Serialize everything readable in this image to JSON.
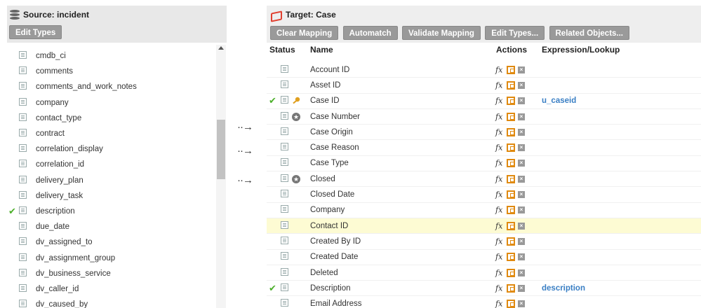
{
  "source": {
    "title": "Source: incident",
    "edit_types_label": "Edit Types",
    "rows": [
      {
        "label": "",
        "checked": false
      },
      {
        "label": "cmdb_ci",
        "checked": false
      },
      {
        "label": "comments",
        "checked": false
      },
      {
        "label": "comments_and_work_notes",
        "checked": false
      },
      {
        "label": "company",
        "checked": false
      },
      {
        "label": "contact_type",
        "checked": false
      },
      {
        "label": "contract",
        "checked": false
      },
      {
        "label": "correlation_display",
        "checked": false
      },
      {
        "label": "correlation_id",
        "checked": false
      },
      {
        "label": "delivery_plan",
        "checked": false
      },
      {
        "label": "delivery_task",
        "checked": false
      },
      {
        "label": "description",
        "checked": true
      },
      {
        "label": "due_date",
        "checked": false
      },
      {
        "label": "dv_assigned_to",
        "checked": false
      },
      {
        "label": "dv_assignment_group",
        "checked": false
      },
      {
        "label": "dv_business_service",
        "checked": false
      },
      {
        "label": "dv_caller_id",
        "checked": false
      },
      {
        "label": "dv_caused_by",
        "checked": false
      }
    ]
  },
  "arrows": [
    "··→",
    "··→",
    "··→"
  ],
  "target": {
    "title": "Target: Case",
    "buttons": {
      "clear_mapping": "Clear Mapping",
      "automatch": "Automatch",
      "validate_mapping": "Validate Mapping",
      "edit_types": "Edit Types...",
      "related_objects": "Related Objects..."
    },
    "columns": {
      "status": "Status",
      "name": "Name",
      "actions": "Actions",
      "expression": "Expression/Lookup"
    },
    "fx_label": "fx",
    "delete_glyph": "×",
    "rows": [
      {
        "name": "Account ID",
        "checked": false,
        "marker": "",
        "expression": ""
      },
      {
        "name": "Asset ID",
        "checked": false,
        "marker": "",
        "expression": ""
      },
      {
        "name": "Case ID",
        "checked": true,
        "marker": "key",
        "expression": "u_caseid"
      },
      {
        "name": "Case Number",
        "checked": false,
        "marker": "star",
        "expression": ""
      },
      {
        "name": "Case Origin",
        "checked": false,
        "marker": "",
        "expression": ""
      },
      {
        "name": "Case Reason",
        "checked": false,
        "marker": "",
        "expression": ""
      },
      {
        "name": "Case Type",
        "checked": false,
        "marker": "",
        "expression": ""
      },
      {
        "name": "Closed",
        "checked": false,
        "marker": "star",
        "expression": ""
      },
      {
        "name": "Closed Date",
        "checked": false,
        "marker": "",
        "expression": ""
      },
      {
        "name": "Company",
        "checked": false,
        "marker": "",
        "expression": ""
      },
      {
        "name": "Contact ID",
        "checked": false,
        "marker": "",
        "expression": "",
        "highlight": true
      },
      {
        "name": "Created By ID",
        "checked": false,
        "marker": "",
        "expression": ""
      },
      {
        "name": "Created Date",
        "checked": false,
        "marker": "",
        "expression": ""
      },
      {
        "name": "Deleted",
        "checked": false,
        "marker": "",
        "expression": ""
      },
      {
        "name": "Description",
        "checked": true,
        "marker": "",
        "expression": "description"
      },
      {
        "name": "Email Address",
        "checked": false,
        "marker": "",
        "expression": ""
      }
    ]
  },
  "colors": {
    "check": "#4caf2a",
    "expression": "#3a7fc4",
    "highlight_row": "#fdfbd3",
    "button": "#9a9a9a",
    "lookup_icon": "#e08a10",
    "brand_icon": "#e04030"
  }
}
